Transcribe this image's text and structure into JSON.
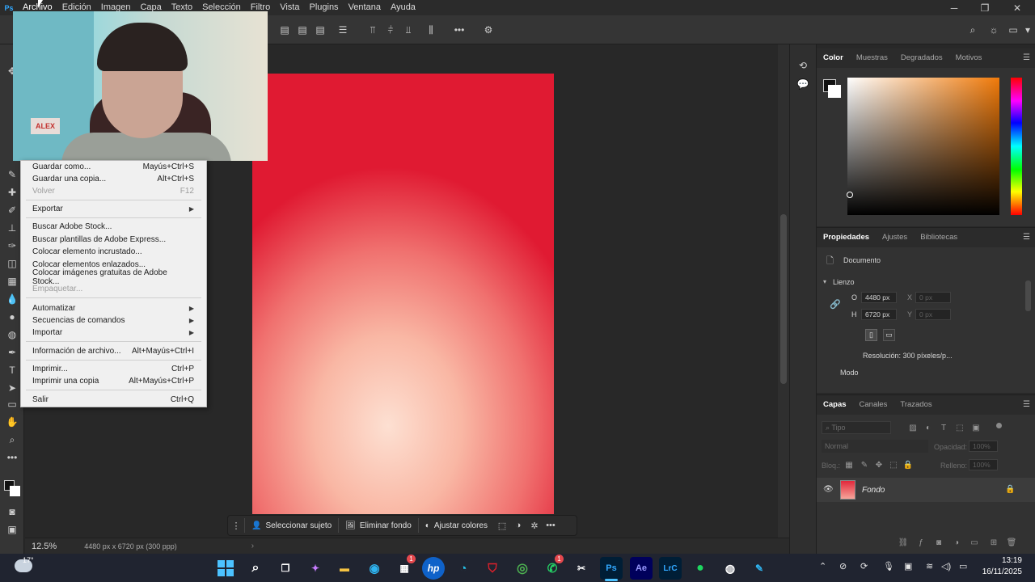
{
  "app": {
    "logo": "Ps"
  },
  "menubar": {
    "items": [
      "Archivo",
      "Edición",
      "Imagen",
      "Capa",
      "Texto",
      "Selección",
      "Filtro",
      "Vista",
      "Plugins",
      "Ventana",
      "Ayuda"
    ],
    "active": "Archivo"
  },
  "window_controls": {
    "minimize": "─",
    "restore": "❐",
    "close": "✕"
  },
  "file_menu": {
    "items": [
      {
        "label": "Guardar como...",
        "shortcut": "Mayús+Ctrl+S",
        "disabled": false
      },
      {
        "label": "Guardar una copia...",
        "shortcut": "Alt+Ctrl+S",
        "disabled": false
      },
      {
        "label": "Volver",
        "shortcut": "F12",
        "disabled": true
      },
      {
        "label": "Exportar",
        "shortcut": "",
        "disabled": false,
        "submenu": true
      },
      {
        "label": "Buscar Adobe Stock...",
        "shortcut": "",
        "disabled": false
      },
      {
        "label": "Buscar plantillas de Adobe Express...",
        "shortcut": "",
        "disabled": false
      },
      {
        "label": "Colocar elemento incrustado...",
        "shortcut": "",
        "disabled": false
      },
      {
        "label": "Colocar elementos enlazados...",
        "shortcut": "",
        "disabled": false
      },
      {
        "label": "Colocar imágenes gratuitas de Adobe Stock...",
        "shortcut": "",
        "disabled": false
      },
      {
        "label": "Empaquetar...",
        "shortcut": "",
        "disabled": true
      },
      {
        "label": "Automatizar",
        "shortcut": "",
        "disabled": false,
        "submenu": true
      },
      {
        "label": "Secuencias de comandos",
        "shortcut": "",
        "disabled": false,
        "submenu": true
      },
      {
        "label": "Importar",
        "shortcut": "",
        "disabled": false,
        "submenu": true
      },
      {
        "label": "Información de archivo...",
        "shortcut": "Alt+Mayús+Ctrl+I",
        "disabled": false
      },
      {
        "label": "Imprimir...",
        "shortcut": "Ctrl+P",
        "disabled": false
      },
      {
        "label": "Imprimir una copia",
        "shortcut": "Alt+Mayús+Ctrl+P",
        "disabled": false
      },
      {
        "label": "Salir",
        "shortcut": "Ctrl+Q",
        "disabled": false
      }
    ]
  },
  "webcam": {
    "sign_text": "ALEX"
  },
  "statusbar": {
    "zoom": "12.5%",
    "doc_info": "4480 px x 6720 px (300 ppp)",
    "arrow": "›"
  },
  "context_taskbar": {
    "select_subject": "Seleccionar sujeto",
    "remove_bg": "Eliminar fondo",
    "adjust_colors": "Ajustar colores",
    "more": "•••"
  },
  "color_panel": {
    "tabs": [
      "Color",
      "Muestras",
      "Degradados",
      "Motivos"
    ],
    "active_tab": "Color",
    "hue_color": "#f07a0a",
    "foreground": "#111111",
    "background": "#ffffff"
  },
  "properties_panel": {
    "tabs": [
      "Propiedades",
      "Ajustes",
      "Bibliotecas"
    ],
    "active_tab": "Propiedades",
    "doc_label": "Documento",
    "section": "Lienzo",
    "width_label": "O",
    "width_value": "4480 px",
    "height_label": "H",
    "height_value": "6720 px",
    "x_label": "X",
    "x_value": "0 px",
    "y_label": "Y",
    "y_value": "0 px",
    "resolution": "Resolución: 300 píxeles/p...",
    "mode_label": "Modo"
  },
  "layers_panel": {
    "tabs": [
      "Capas",
      "Canales",
      "Trazados"
    ],
    "active_tab": "Capas",
    "search_placeholder": "Tipo",
    "blend_mode": "Normal",
    "opacity_label": "Opacidad:",
    "opacity_value": "100%",
    "lock_label": "Bloq.:",
    "fill_label": "Relleno:",
    "fill_value": "100%",
    "layers": [
      {
        "name": "Fondo",
        "visible": true,
        "locked": true
      }
    ]
  },
  "taskbar": {
    "weather_temp": "17°",
    "time": "13:19",
    "date": "16/11/2025",
    "apps": [
      "windows-start",
      "search",
      "task-view",
      "copilot",
      "file-explorer",
      "edge",
      "store",
      "hp",
      "browser",
      "mcafee",
      "chrome",
      "whatsapp",
      "capcut",
      "photoshop",
      "after-effects",
      "lightroom-classic",
      "spotify",
      "gamebar",
      "paint"
    ],
    "badges": {
      "store": "1",
      "whatsapp": "1"
    },
    "app_labels": {
      "photoshop": "Ps",
      "after-effects": "Ae",
      "lightroom-classic": "LrC"
    }
  }
}
